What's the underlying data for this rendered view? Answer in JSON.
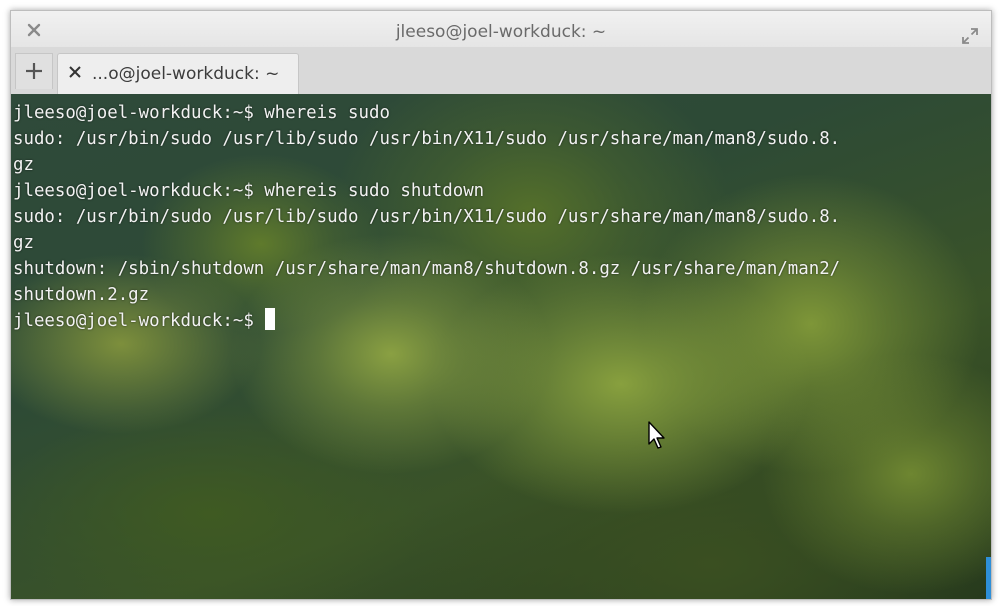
{
  "window": {
    "title": "jleeso@joel-workduck: ~"
  },
  "tabs": [
    {
      "label": "...o@joel-workduck: ~"
    }
  ],
  "icons": {
    "close": "close-icon",
    "maximize": "maximize-icon",
    "new_tab": "plus-icon",
    "tab_close": "tab-close-icon",
    "mouse": "mouse-pointer-icon"
  },
  "terminal": {
    "lines": [
      "jleeso@joel-workduck:~$ whereis sudo",
      "sudo: /usr/bin/sudo /usr/lib/sudo /usr/bin/X11/sudo /usr/share/man/man8/sudo.8.",
      "gz",
      "jleeso@joel-workduck:~$ whereis sudo shutdown",
      "sudo: /usr/bin/sudo /usr/lib/sudo /usr/bin/X11/sudo /usr/share/man/man8/sudo.8.",
      "gz",
      "shutdown: /sbin/shutdown /usr/share/man/man8/shutdown.8.gz /usr/share/man/man2/",
      "shutdown.2.gz"
    ],
    "prompt": "jleeso@joel-workduck:~$ "
  },
  "colors": {
    "text": "#f2f2f2",
    "scrollbar": "#2e8fd8",
    "titlebar": "#e8e8e8"
  }
}
